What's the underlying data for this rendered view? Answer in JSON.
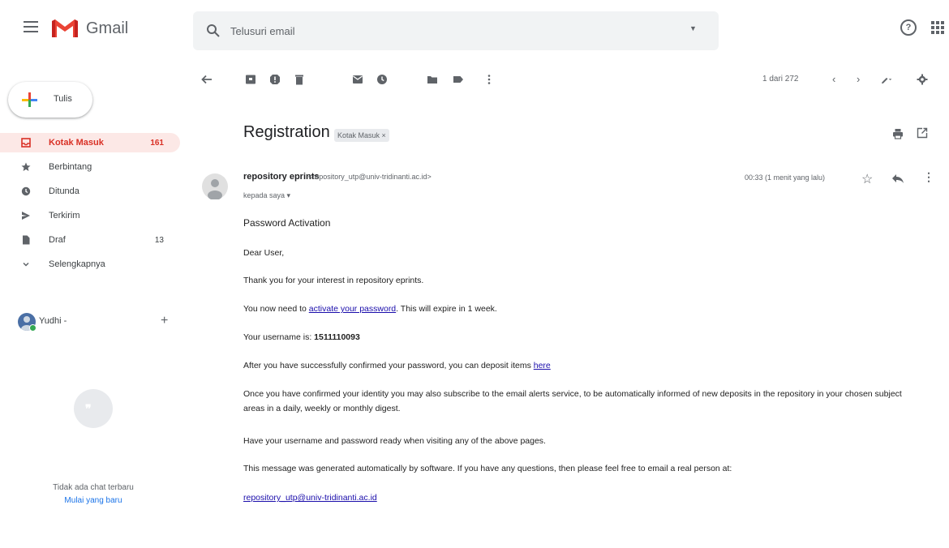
{
  "header": {
    "app_name": "Gmail",
    "search_placeholder": "Telusuri email"
  },
  "sidebar": {
    "compose_label": "Tulis",
    "items": [
      {
        "label": "Kotak Masuk",
        "count": "161",
        "icon": "inbox-icon"
      },
      {
        "label": "Berbintang",
        "count": "",
        "icon": "star-icon"
      },
      {
        "label": "Ditunda",
        "count": "",
        "icon": "clock-icon"
      },
      {
        "label": "Terkirim",
        "count": "",
        "icon": "send-icon"
      },
      {
        "label": "Draf",
        "count": "13",
        "icon": "draft-icon"
      },
      {
        "label": "Selengkapnya",
        "count": "",
        "icon": "chevron-down-icon"
      }
    ],
    "user_name": "Yudhi -",
    "hangouts_empty": "Tidak ada chat terbaru",
    "hangouts_start": "Mulai yang baru"
  },
  "toolbar": {
    "pager": "1 dari 272"
  },
  "message": {
    "subject": "Registration",
    "label": "Kotak Masuk ×",
    "sender_name": "repository eprints",
    "sender_email": "<repository_utp@univ-tridinanti.ac.id>",
    "recipient": "kepada saya ▾",
    "time": "00:33 (1 menit yang lalu)",
    "lines": {
      "title": "Password Activation",
      "greeting": "Dear User,",
      "thanks": "Thank you for your interest in repository eprints.",
      "activate_prefix": "You now need to ",
      "activate_link": "activate your password",
      "activate_suffix": ". This will expire in 1 week.",
      "username_prefix": "Your username is: ",
      "username_value": "1511110093",
      "deposit_prefix": "After you have successfully confirmed your password, you can deposit items ",
      "deposit_link": "here",
      "subscribe": "Once you have confirmed your identity you may also subscribe to the email alerts service, to be automatically informed of new deposits in the repository in your chosen subject areas in a daily, weekly or monthly digest.",
      "ready": "Have your username and password ready when visiting any of the above pages.",
      "generated": "This message was generated automatically by software. If you have any questions, then please feel free to email a real person at:",
      "contact_link": "repository_utp@univ-tridinanti.ac.id"
    }
  },
  "colors": {
    "accent_red": "#d93025",
    "active_bg": "#fce8e6",
    "link": "#1a0dab"
  }
}
